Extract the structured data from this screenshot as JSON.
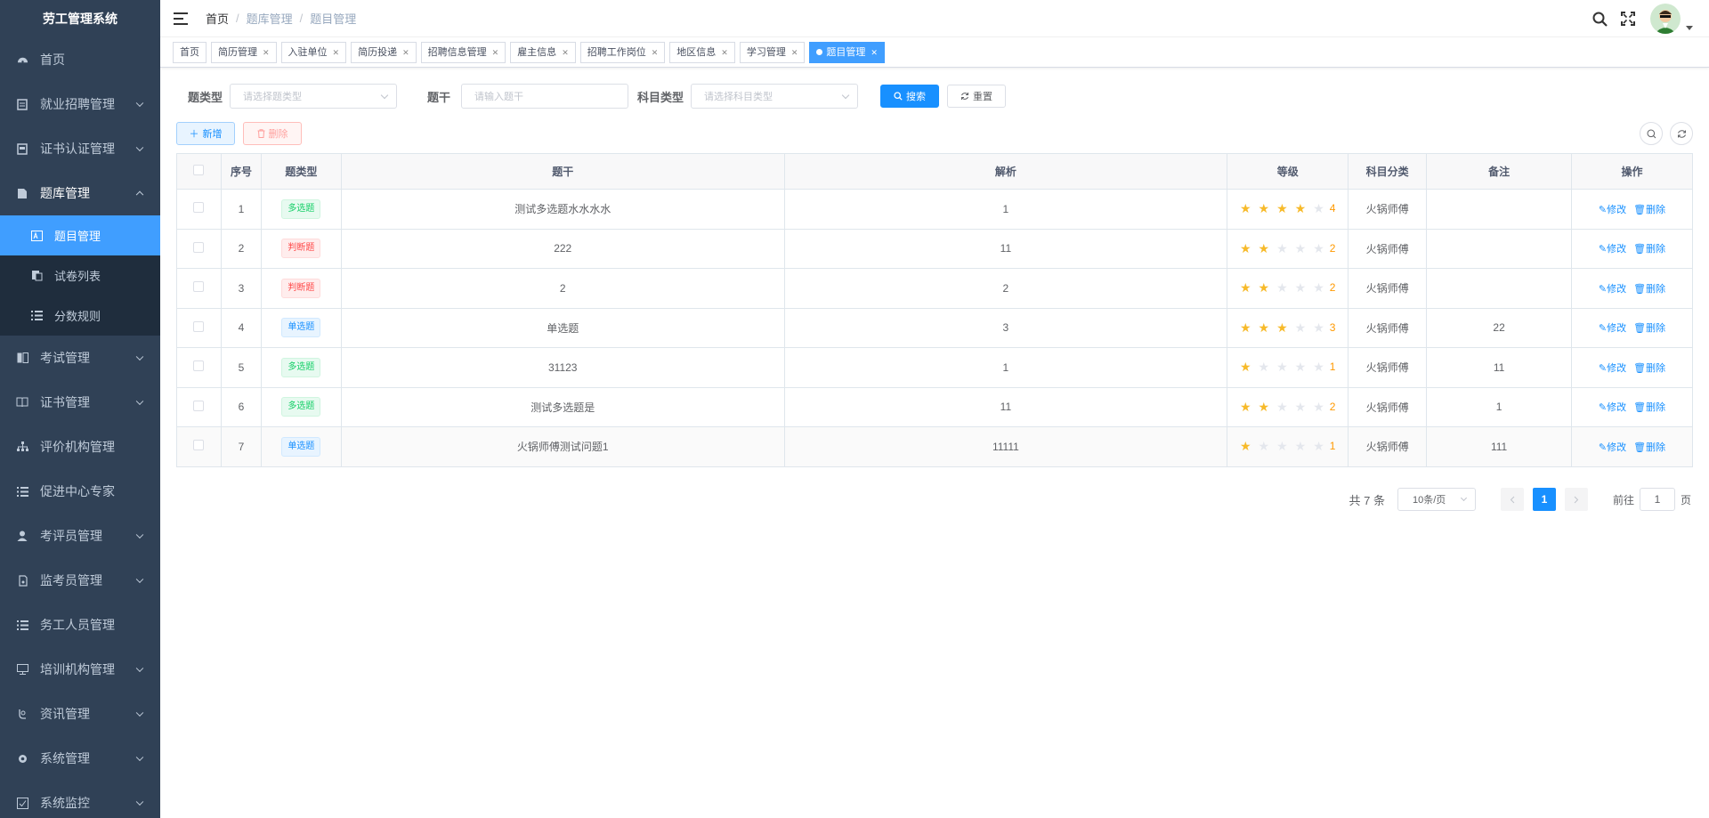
{
  "app": {
    "title": "劳工管理系统"
  },
  "sidebar": {
    "items": [
      {
        "label": "首页",
        "icon": "dashboard-icon"
      },
      {
        "label": "就业招聘管理",
        "icon": "document-icon"
      },
      {
        "label": "证书认证管理",
        "icon": "certificate-icon"
      },
      {
        "label": "题库管理",
        "icon": "book-icon"
      },
      {
        "label": "考试管理",
        "icon": "exam-icon"
      },
      {
        "label": "证书管理",
        "icon": "book-open-icon"
      },
      {
        "label": "评价机构管理",
        "icon": "tree-icon"
      },
      {
        "label": "促进中心专家",
        "icon": "list-icon"
      },
      {
        "label": "考评员管理",
        "icon": "user-icon"
      },
      {
        "label": "监考员管理",
        "icon": "monitor-icon"
      },
      {
        "label": "务工人员管理",
        "icon": "list-icon"
      },
      {
        "label": "培训机构管理",
        "icon": "screen-icon"
      },
      {
        "label": "资讯管理",
        "icon": "news-icon"
      },
      {
        "label": "系统管理",
        "icon": "gear-icon"
      },
      {
        "label": "系统监控",
        "icon": "monitor-check-icon"
      }
    ],
    "submenu": [
      {
        "label": "题目管理",
        "icon": "question-icon"
      },
      {
        "label": "试卷列表",
        "icon": "paper-icon"
      },
      {
        "label": "分数规则",
        "icon": "list-icon"
      }
    ]
  },
  "header": {
    "breadcrumb": [
      "首页",
      "题库管理",
      "题目管理"
    ]
  },
  "tags": [
    {
      "label": "首页",
      "closable": false
    },
    {
      "label": "简历管理",
      "closable": true
    },
    {
      "label": "入驻单位",
      "closable": true
    },
    {
      "label": "简历投递",
      "closable": true
    },
    {
      "label": "招聘信息管理",
      "closable": true
    },
    {
      "label": "雇主信息",
      "closable": true
    },
    {
      "label": "招聘工作岗位",
      "closable": true
    },
    {
      "label": "地区信息",
      "closable": true
    },
    {
      "label": "学习管理",
      "closable": true
    },
    {
      "label": "题目管理",
      "closable": true
    }
  ],
  "search": {
    "type_label": "题类型",
    "type_placeholder": "请选择题类型",
    "stem_label": "题干",
    "stem_placeholder": "请输入题干",
    "subject_label": "科目类型",
    "subject_placeholder": "请选择科目类型",
    "search_button": "搜索",
    "reset_button": "重置"
  },
  "toolbar": {
    "add_button": "新增",
    "delete_button": "删除"
  },
  "table": {
    "columns": [
      "序号",
      "题类型",
      "题干",
      "解析",
      "等级",
      "科目分类",
      "备注",
      "操作"
    ],
    "edit_label": "修改",
    "delete_label": "删除",
    "rows": [
      {
        "no": "1",
        "type": "多选题",
        "type_color": "green",
        "stem": "测试多选题水水水水",
        "analysis": "1",
        "level": 4,
        "level_text": "4",
        "subject": "火锅师傅",
        "remark": ""
      },
      {
        "no": "2",
        "type": "判断题",
        "type_color": "red",
        "stem": "222",
        "analysis": "11",
        "level": 2,
        "level_text": "2",
        "subject": "火锅师傅",
        "remark": ""
      },
      {
        "no": "3",
        "type": "判断题",
        "type_color": "red",
        "stem": "2",
        "analysis": "2",
        "level": 2,
        "level_text": "2",
        "subject": "火锅师傅",
        "remark": ""
      },
      {
        "no": "4",
        "type": "单选题",
        "type_color": "blue",
        "stem": "单选题",
        "analysis": "3",
        "level": 3,
        "level_text": "3",
        "subject": "火锅师傅",
        "remark": "22"
      },
      {
        "no": "5",
        "type": "多选题",
        "type_color": "green",
        "stem": "31123",
        "analysis": "1",
        "level": 1,
        "level_text": "1",
        "subject": "火锅师傅",
        "remark": "11"
      },
      {
        "no": "6",
        "type": "多选题",
        "type_color": "green",
        "stem": "测试多选题是",
        "analysis": "11",
        "level": 2,
        "level_text": "2",
        "subject": "火锅师傅",
        "remark": "1"
      },
      {
        "no": "7",
        "type": "单选题",
        "type_color": "blue",
        "stem": "火锅师傅测试问题1",
        "analysis": "11111",
        "level": 1,
        "level_text": "1",
        "subject": "火锅师傅",
        "remark": "111"
      }
    ]
  },
  "pagination": {
    "total_text": "共 7 条",
    "page_size": "10条/页",
    "current_page": "1",
    "goto_label": "前往",
    "goto_value": "1",
    "page_suffix": "页"
  },
  "colors": {
    "sidebar_bg": "#304156",
    "submenu_bg": "#1f2d3d",
    "primary": "#1890ff",
    "star": "#f7ba2a"
  }
}
